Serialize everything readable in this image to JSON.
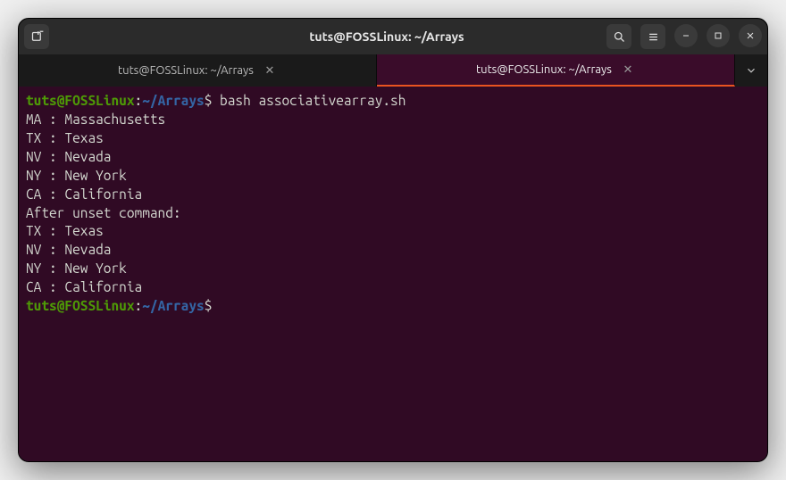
{
  "window": {
    "title": "tuts@FOSSLinux: ~/Arrays"
  },
  "tabs": [
    {
      "label": "tuts@FOSSLinux: ~/Arrays",
      "active": false
    },
    {
      "label": "tuts@FOSSLinux: ~/Arrays",
      "active": true
    }
  ],
  "prompt": {
    "user": "tuts",
    "host": "FOSSLinux",
    "separator": "@",
    "path": "~/Arrays",
    "colon": ":",
    "dollar": "$"
  },
  "commands": [
    {
      "cmd": " bash associativearray.sh"
    },
    {
      "cmd": ""
    }
  ],
  "output_lines": [
    "MA : Massachusetts",
    "TX : Texas",
    "NV : Nevada",
    "NY : New York",
    "CA : California",
    "After unset command:",
    "TX : Texas",
    "NV : Nevada",
    "NY : New York",
    "CA : California"
  ]
}
